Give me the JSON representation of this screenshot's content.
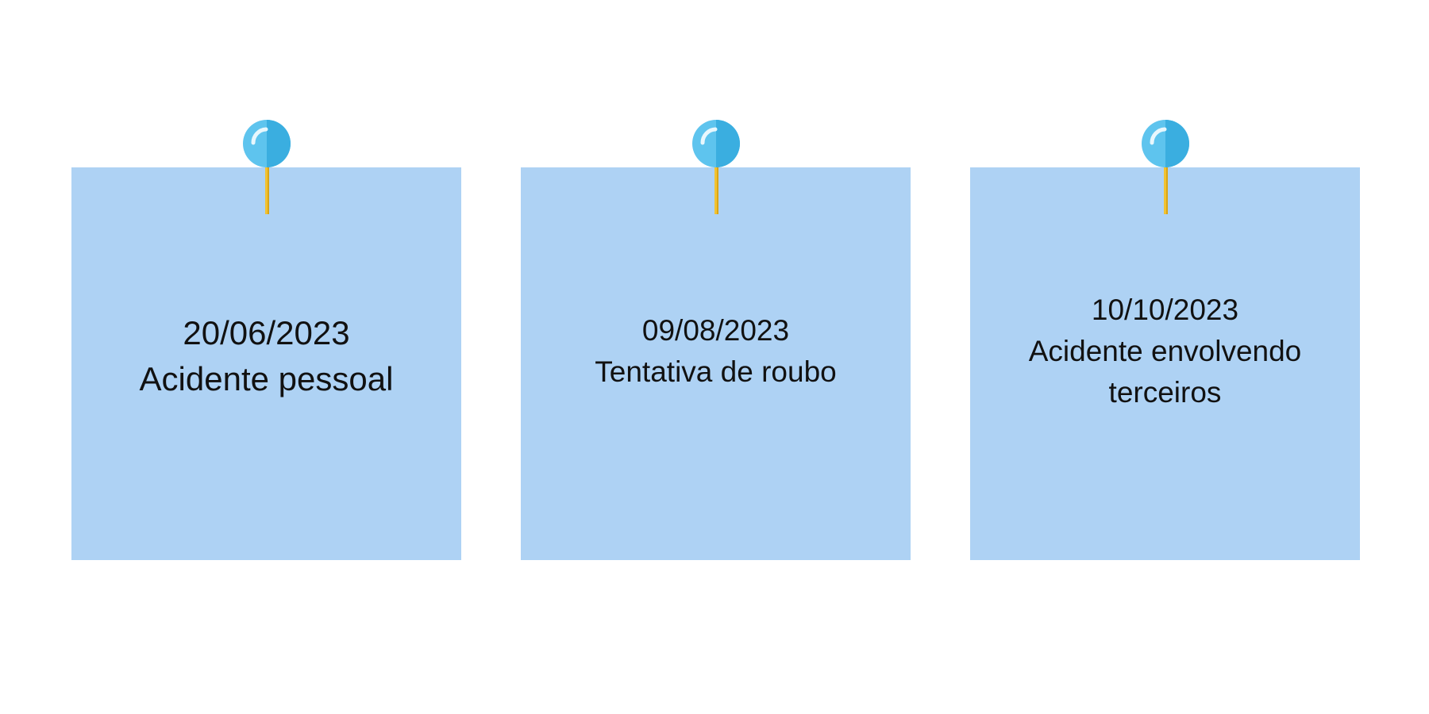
{
  "notes": [
    {
      "date": "20/06/2023",
      "description": "Acidente pessoal"
    },
    {
      "date": "09/08/2023",
      "description": "Tentativa de roubo"
    },
    {
      "date": "10/10/2023",
      "description": "Acidente envolvendo terceiros"
    }
  ],
  "colors": {
    "background": "#ffffff",
    "note": "#aed2f4",
    "pin_head_light": "#5ec4ee",
    "pin_head_dark": "#3aaee0",
    "pin_needle": "#f2c230",
    "text": "#111111"
  },
  "icons": {
    "pin": "pushpin-icon"
  }
}
